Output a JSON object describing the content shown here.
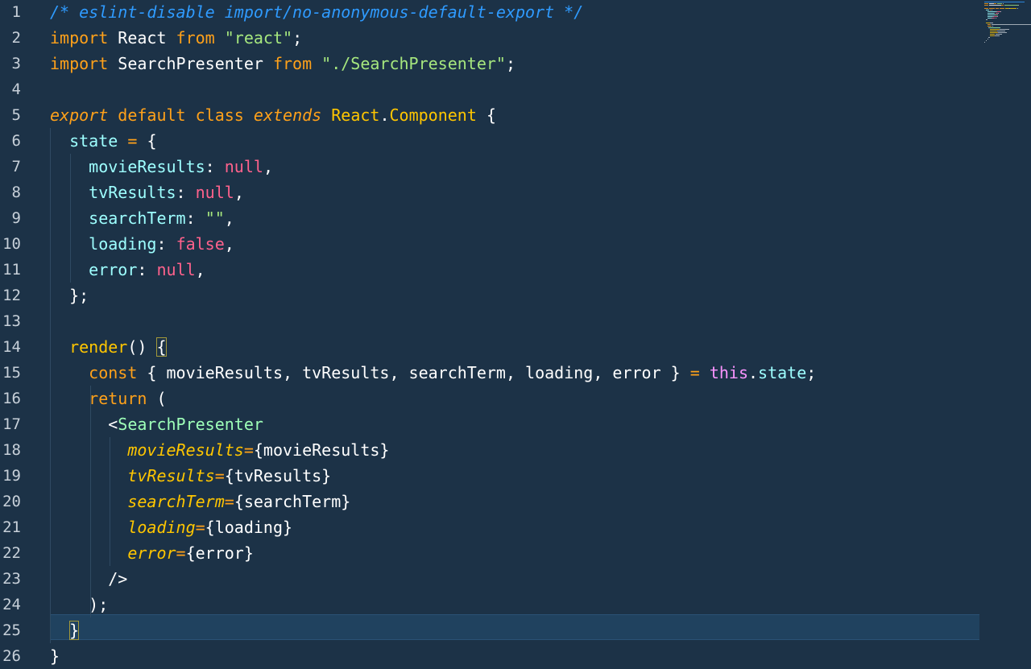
{
  "editor": {
    "line_numbers": [
      "1",
      "2",
      "3",
      "4",
      "5",
      "6",
      "7",
      "8",
      "9",
      "10",
      "11",
      "12",
      "13",
      "14",
      "15",
      "16",
      "17",
      "18",
      "19",
      "20",
      "21",
      "22",
      "23",
      "24",
      "25",
      "26"
    ],
    "current_line": "25",
    "lines": [
      [
        {
          "t": "/* eslint-disable import/no-anonymous-default-export */",
          "c": "comment"
        }
      ],
      [
        {
          "t": "import",
          "c": "keyword"
        },
        {
          "t": " React ",
          "c": "ident"
        },
        {
          "t": "from",
          "c": "keyword"
        },
        {
          "t": " ",
          "c": "plain"
        },
        {
          "t": "\"react\"",
          "c": "string"
        },
        {
          "t": ";",
          "c": "plain"
        }
      ],
      [
        {
          "t": "import",
          "c": "keyword"
        },
        {
          "t": " SearchPresenter ",
          "c": "ident"
        },
        {
          "t": "from",
          "c": "keyword"
        },
        {
          "t": " ",
          "c": "plain"
        },
        {
          "t": "\"./SearchPresenter\"",
          "c": "string"
        },
        {
          "t": ";",
          "c": "plain"
        }
      ],
      [],
      [
        {
          "t": "export",
          "c": "storage"
        },
        {
          "t": " ",
          "c": "plain"
        },
        {
          "t": "default",
          "c": "keyword"
        },
        {
          "t": " ",
          "c": "plain"
        },
        {
          "t": "class",
          "c": "keyword"
        },
        {
          "t": " ",
          "c": "plain"
        },
        {
          "t": "extends",
          "c": "storage"
        },
        {
          "t": " ",
          "c": "plain"
        },
        {
          "t": "React",
          "c": "class"
        },
        {
          "t": ".",
          "c": "plain"
        },
        {
          "t": "Component",
          "c": "class"
        },
        {
          "t": " {",
          "c": "plain"
        }
      ],
      [
        {
          "t": "  ",
          "c": "plain"
        },
        {
          "t": "state",
          "c": "prop"
        },
        {
          "t": " ",
          "c": "plain"
        },
        {
          "t": "=",
          "c": "op"
        },
        {
          "t": " {",
          "c": "plain"
        }
      ],
      [
        {
          "t": "    ",
          "c": "plain"
        },
        {
          "t": "movieResults",
          "c": "prop"
        },
        {
          "t": ": ",
          "c": "plain"
        },
        {
          "t": "null",
          "c": "null"
        },
        {
          "t": ",",
          "c": "plain"
        }
      ],
      [
        {
          "t": "    ",
          "c": "plain"
        },
        {
          "t": "tvResults",
          "c": "prop"
        },
        {
          "t": ": ",
          "c": "plain"
        },
        {
          "t": "null",
          "c": "null"
        },
        {
          "t": ",",
          "c": "plain"
        }
      ],
      [
        {
          "t": "    ",
          "c": "plain"
        },
        {
          "t": "searchTerm",
          "c": "prop"
        },
        {
          "t": ": ",
          "c": "plain"
        },
        {
          "t": "\"\"",
          "c": "string"
        },
        {
          "t": ",",
          "c": "plain"
        }
      ],
      [
        {
          "t": "    ",
          "c": "plain"
        },
        {
          "t": "loading",
          "c": "prop"
        },
        {
          "t": ": ",
          "c": "plain"
        },
        {
          "t": "false",
          "c": "null"
        },
        {
          "t": ",",
          "c": "plain"
        }
      ],
      [
        {
          "t": "    ",
          "c": "plain"
        },
        {
          "t": "error",
          "c": "prop"
        },
        {
          "t": ": ",
          "c": "plain"
        },
        {
          "t": "null",
          "c": "null"
        },
        {
          "t": ",",
          "c": "plain"
        }
      ],
      [
        {
          "t": "  };",
          "c": "plain"
        }
      ],
      [],
      [
        {
          "t": "  ",
          "c": "plain"
        },
        {
          "t": "render",
          "c": "func"
        },
        {
          "t": "() ",
          "c": "plain"
        },
        {
          "t": "{",
          "c": "plain",
          "m": 1
        }
      ],
      [
        {
          "t": "    ",
          "c": "plain"
        },
        {
          "t": "const",
          "c": "keyword"
        },
        {
          "t": " { movieResults, tvResults, searchTerm, loading, error } ",
          "c": "plain"
        },
        {
          "t": "=",
          "c": "op"
        },
        {
          "t": " ",
          "c": "plain"
        },
        {
          "t": "this",
          "c": "this"
        },
        {
          "t": ".",
          "c": "plain"
        },
        {
          "t": "state",
          "c": "prop"
        },
        {
          "t": ";",
          "c": "plain"
        }
      ],
      [
        {
          "t": "    ",
          "c": "plain"
        },
        {
          "t": "return",
          "c": "keyword"
        },
        {
          "t": " (",
          "c": "plain"
        }
      ],
      [
        {
          "t": "      <",
          "c": "plain"
        },
        {
          "t": "SearchPresenter",
          "c": "tag"
        }
      ],
      [
        {
          "t": "        ",
          "c": "plain"
        },
        {
          "t": "movieResults",
          "c": "attr"
        },
        {
          "t": "=",
          "c": "op"
        },
        {
          "t": "{movieResults}",
          "c": "plain"
        }
      ],
      [
        {
          "t": "        ",
          "c": "plain"
        },
        {
          "t": "tvResults",
          "c": "attr"
        },
        {
          "t": "=",
          "c": "op"
        },
        {
          "t": "{tvResults}",
          "c": "plain"
        }
      ],
      [
        {
          "t": "        ",
          "c": "plain"
        },
        {
          "t": "searchTerm",
          "c": "attr"
        },
        {
          "t": "=",
          "c": "op"
        },
        {
          "t": "{searchTerm}",
          "c": "plain"
        }
      ],
      [
        {
          "t": "        ",
          "c": "plain"
        },
        {
          "t": "loading",
          "c": "attr"
        },
        {
          "t": "=",
          "c": "op"
        },
        {
          "t": "{loading}",
          "c": "plain"
        }
      ],
      [
        {
          "t": "        ",
          "c": "plain"
        },
        {
          "t": "error",
          "c": "attr"
        },
        {
          "t": "=",
          "c": "op"
        },
        {
          "t": "{error}",
          "c": "plain"
        }
      ],
      [
        {
          "t": "      />",
          "c": "plain"
        }
      ],
      [
        {
          "t": "    );",
          "c": "plain"
        }
      ],
      [
        {
          "t": "  ",
          "c": "plain"
        },
        {
          "t": "}",
          "c": "plain",
          "m": 1
        }
      ],
      [
        {
          "t": "}",
          "c": "plain"
        }
      ]
    ]
  },
  "colors": {
    "background": "#1c3247",
    "current_line": "#20425f",
    "comment": "#2f9bff",
    "keyword": "#ffa11a",
    "string": "#a6e77e",
    "constant": "#ff628c",
    "property": "#9effff",
    "tag": "#9effb8",
    "this": "#fb94ff"
  }
}
